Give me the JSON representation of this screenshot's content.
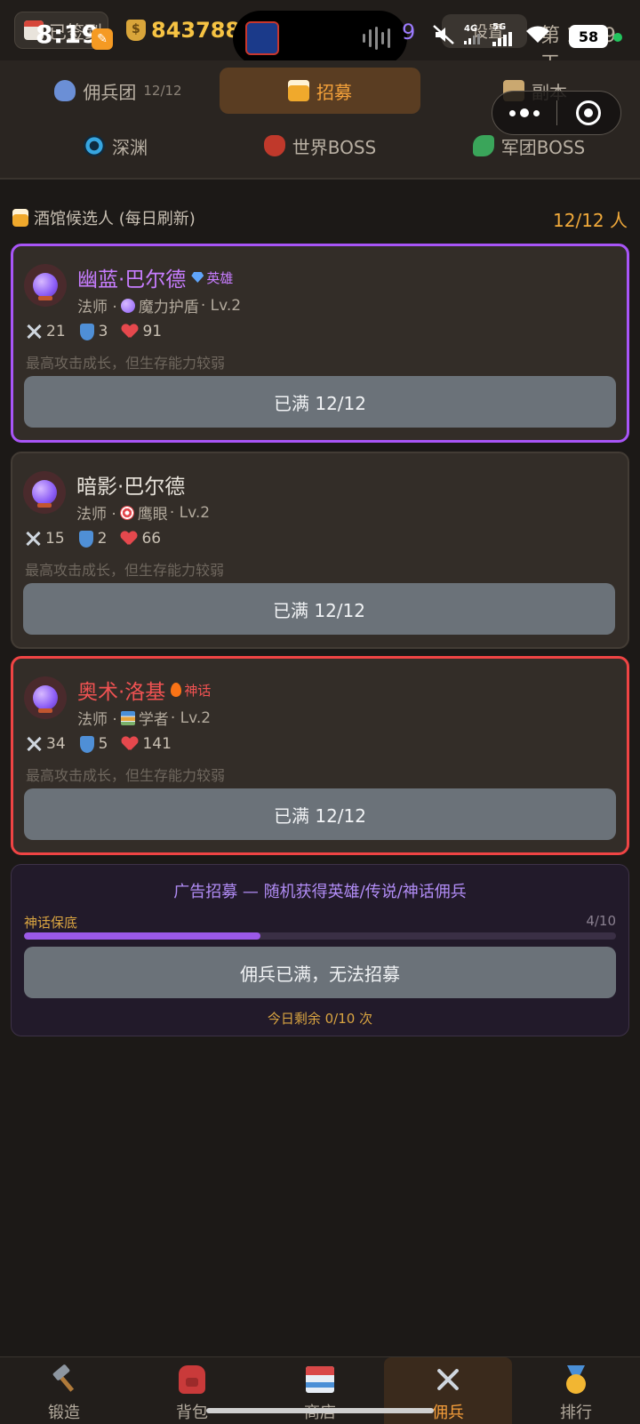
{
  "status_bar": {
    "time": "8:19",
    "checkin_label": "已签到",
    "gold": "8437881",
    "settings_label": "设置",
    "net_4g": "4G",
    "net_5g": "5G",
    "day_label": "第 1609 天",
    "battery": "58",
    "island_digit": "9"
  },
  "tabs": {
    "row1": [
      {
        "label": "佣兵团",
        "count": "12/12",
        "icon": "mercenary-icon"
      },
      {
        "label": "招募",
        "icon": "beer-icon"
      },
      {
        "label": "副本",
        "icon": "scroll-icon"
      }
    ],
    "row2": [
      {
        "label": "深渊",
        "icon": "abyss-swirl-icon"
      },
      {
        "label": "世界BOSS",
        "icon": "oni-mask-icon"
      },
      {
        "label": "军团BOSS",
        "icon": "dragon-icon"
      }
    ]
  },
  "section": {
    "title": "酒馆候选人 (每日刷新)",
    "count": "12/12 人"
  },
  "candidates": [
    {
      "name": "幽蓝·巴尔德",
      "rarity": "英雄",
      "name_color": "#c77dff",
      "rarity_color": "#c77dff",
      "class": "法师 · ",
      "skill": "魔力护盾",
      "level": " · Lv.2",
      "atk": "21",
      "def": "3",
      "hp": "91",
      "desc": "最高攻击成长，但生存能力较弱",
      "button": "已满 12/12"
    },
    {
      "name": "暗影·巴尔德",
      "rarity": "",
      "name_color": "#e7e2da",
      "rarity_color": "#e7e2da",
      "class": "法师 · ",
      "skill": "鹰眼",
      "level": " · Lv.2",
      "atk": "15",
      "def": "2",
      "hp": "66",
      "desc": "最高攻击成长，但生存能力较弱",
      "button": "已满 12/12"
    },
    {
      "name": "奥术·洛基",
      "rarity": "神话",
      "name_color": "#f05252",
      "rarity_color": "#f05252",
      "class": "法师 · ",
      "skill": "学者",
      "level": " · Lv.2",
      "atk": "34",
      "def": "5",
      "hp": "141",
      "desc": "最高攻击成长，但生存能力较弱",
      "button": "已满 12/12"
    }
  ],
  "ad_recruit": {
    "title": "广告招募 — 随机获得英雄/传说/神话佣兵",
    "pity_label": "神话保底",
    "pity_count": "4/10",
    "pity_progress": 0.4,
    "button": "佣兵已满，无法招募",
    "remaining": "今日剩余 0/10 次"
  },
  "bottom_nav": [
    {
      "label": "锻造",
      "icon": "hammer-icon"
    },
    {
      "label": "背包",
      "icon": "backpack-icon"
    },
    {
      "label": "商店",
      "icon": "store-icon"
    },
    {
      "label": "佣兵",
      "icon": "crossed-swords-icon",
      "active": true
    },
    {
      "label": "排行",
      "icon": "medal-icon"
    }
  ]
}
